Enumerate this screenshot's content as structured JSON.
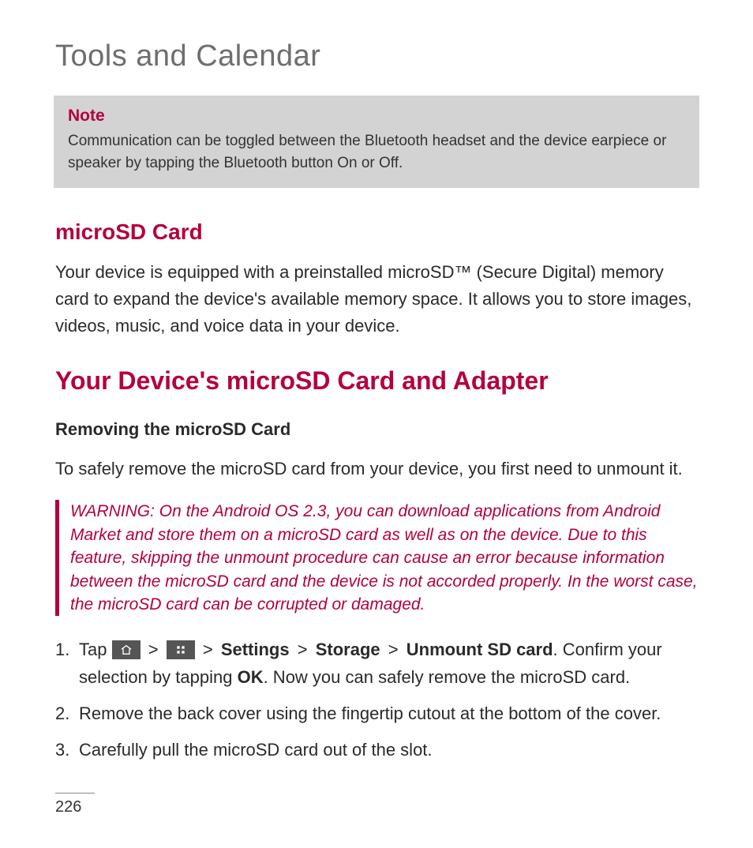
{
  "page_title": "Tools and Calendar",
  "note": {
    "title": "Note",
    "body": "Communication can be toggled between the Bluetooth headset and the device earpiece or speaker by tapping the Bluetooth button On or Off."
  },
  "section1": {
    "heading": "microSD Card",
    "body": "Your device is equipped with a preinstalled microSD™ (Secure Digital) memory card to expand the device's available memory space. It allows you to store images, videos, music, and voice data in your device."
  },
  "section2": {
    "heading": "Your Device's microSD Card and Adapter",
    "subheading": "Removing the microSD Card",
    "intro": "To safely remove the microSD card from your device, you first need to unmount it.",
    "warning": "WARNING:  On the Android OS 2.3, you can download applications from Android Market and store them on a microSD card as well as on the device. Due to this feature, skipping the unmount procedure can cause an error because information between the microSD card and the device is not accorded properly. In the worst case, the microSD card can be corrupted or damaged.",
    "steps": {
      "step1_pre": "Tap ",
      "step1_sep": ">",
      "step1_labels": {
        "settings": "Settings",
        "storage": "Storage",
        "unmount": "Unmount SD card"
      },
      "step1_post1": ". Confirm your selection by tapping ",
      "step1_ok": "OK",
      "step1_post2": ". Now you can safely remove the microSD card.",
      "step2": "Remove the back cover using the fingertip cutout at the bottom of the cover.",
      "step3": "Carefully pull the microSD card out of the slot."
    }
  },
  "page_number": "226"
}
